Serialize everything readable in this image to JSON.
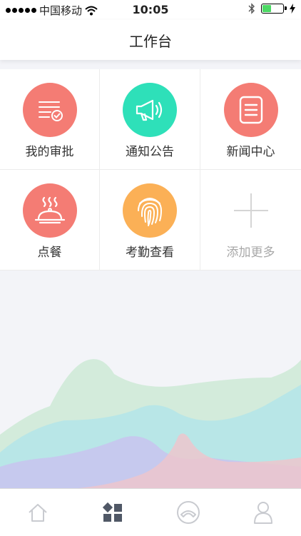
{
  "status_bar": {
    "carrier": "中国移动",
    "time": "10:05"
  },
  "header": {
    "title": "工作台"
  },
  "grid": {
    "items": [
      {
        "label": "我的审批",
        "icon": "approval-list-icon",
        "color": "#f47c74"
      },
      {
        "label": "通知公告",
        "icon": "megaphone-icon",
        "color": "#2ee0b9"
      },
      {
        "label": "新闻中心",
        "icon": "news-document-icon",
        "color": "#f47c74"
      },
      {
        "label": "点餐",
        "icon": "food-cloche-icon",
        "color": "#f47c74"
      },
      {
        "label": "考勤查看",
        "icon": "fingerprint-icon",
        "color": "#fbb056"
      },
      {
        "label": "添加更多",
        "icon": "plus-icon",
        "color": "#d5d5d5"
      }
    ]
  },
  "tabbar": {
    "tabs": [
      {
        "icon": "home-icon",
        "active": false
      },
      {
        "icon": "workbench-grid-icon",
        "active": true
      },
      {
        "icon": "phone-icon",
        "active": false
      },
      {
        "icon": "user-icon",
        "active": false
      }
    ],
    "active_color": "#505866",
    "inactive_color": "#c9cbd0"
  },
  "colors": {
    "background": "#f3f4f8",
    "wave_green": "#cde9d6",
    "wave_cyan": "#b5e6e8",
    "wave_purple": "#c8c3ee",
    "wave_pink": "#ecc5cc"
  }
}
